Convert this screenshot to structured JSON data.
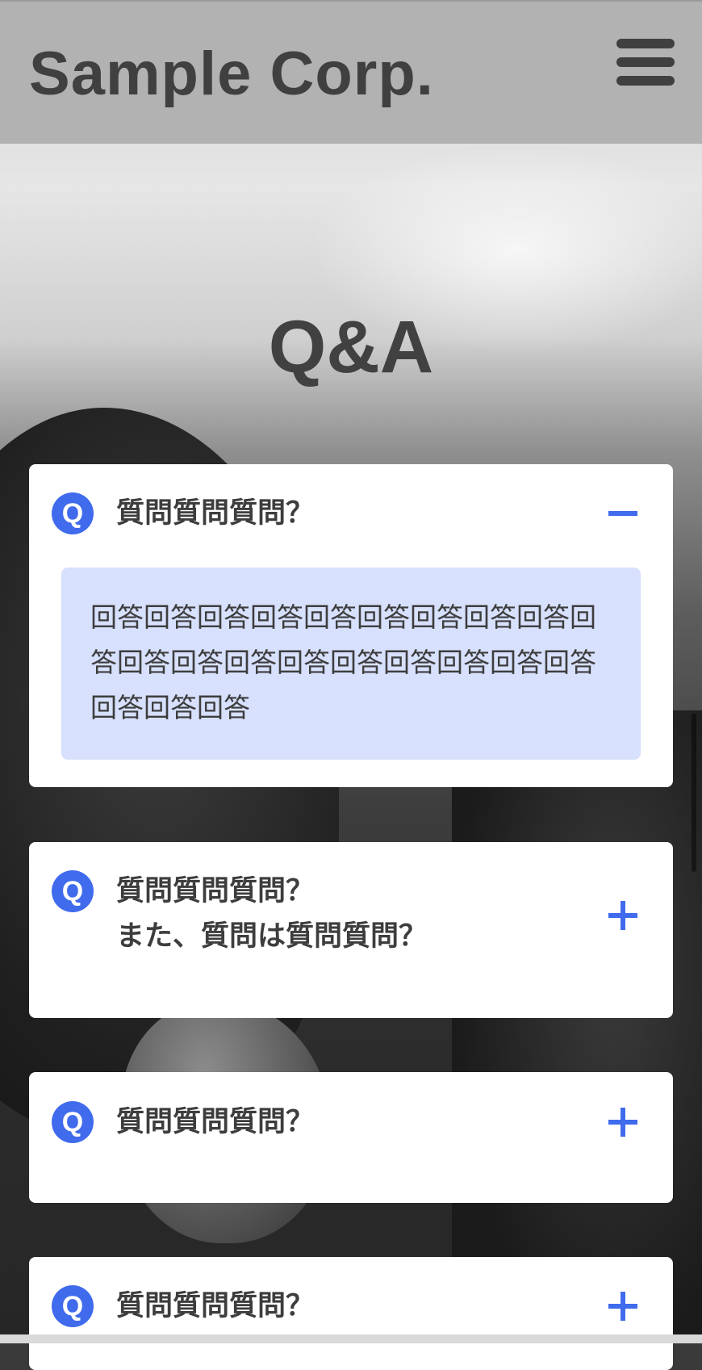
{
  "header": {
    "brand": "Sample Corp.",
    "menu_icon": "hamburger-menu-icon"
  },
  "hero": {
    "title": "Q&A"
  },
  "faq": {
    "badge_label": "Q",
    "items": [
      {
        "question_line1": "質問質問質問？",
        "question_line2": "",
        "expanded": true,
        "toggle_icon": "minus-icon",
        "answer": "回答回答回答回答回答回答回答回答回答回答回答回答回答回答回答回答回答回答回答回答回答回答"
      },
      {
        "question_line1": "質問質問質問？",
        "question_line2": "また、質問は質問質問？",
        "expanded": false,
        "toggle_icon": "plus-icon"
      },
      {
        "question_line1": "質問質問質問？",
        "question_line2": "",
        "expanded": false,
        "toggle_icon": "plus-icon"
      },
      {
        "question_line1": "質問質問質問？",
        "question_line2": "",
        "expanded": false,
        "toggle_icon": "plus-icon"
      }
    ]
  },
  "colors": {
    "accent": "#3f6bec",
    "answer_bg": "#d7e0fd",
    "header_bg": "#b2b2b2",
    "text": "#3d3d3d"
  }
}
